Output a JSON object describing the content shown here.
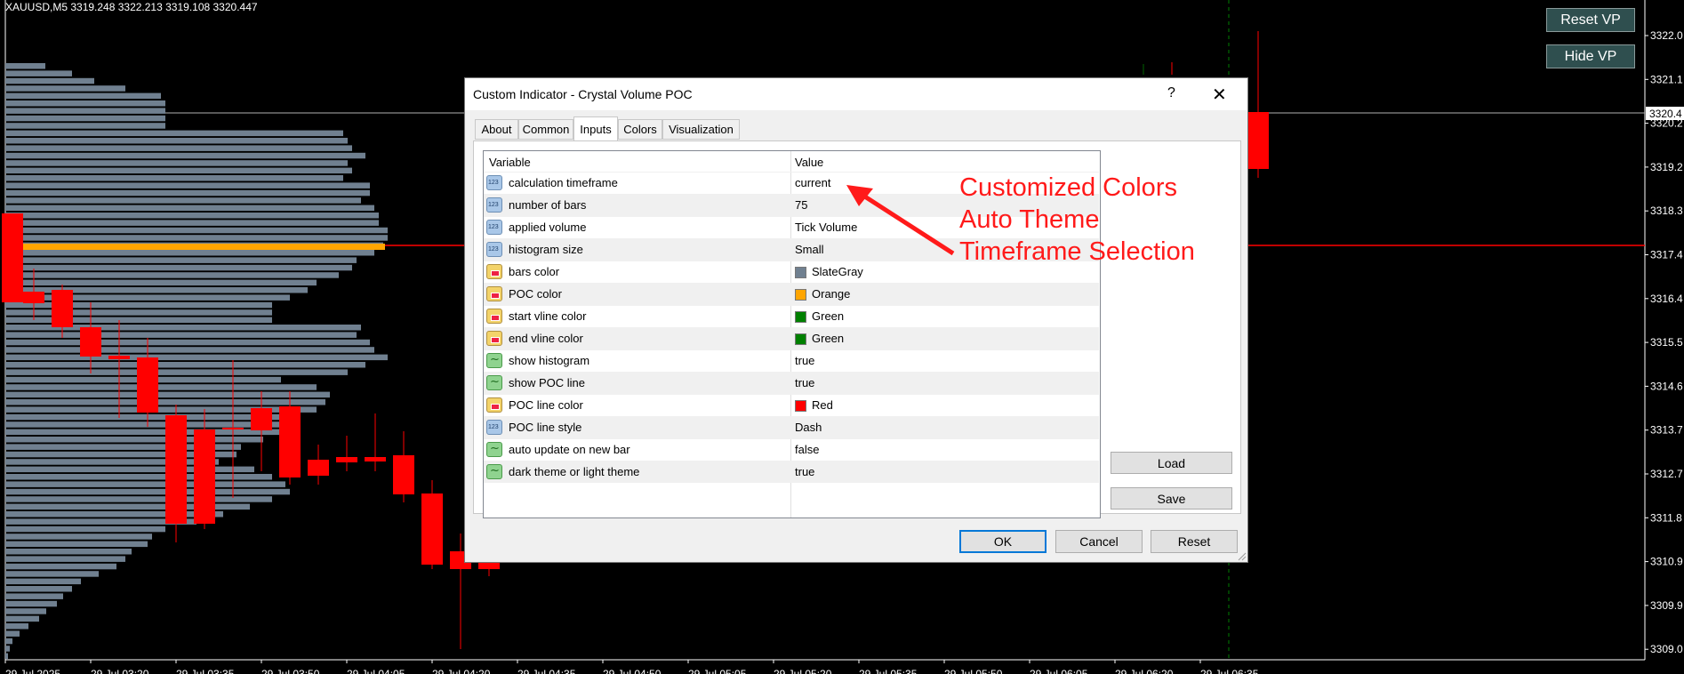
{
  "chart": {
    "symbol_info": "XAUUSD,M5  3319.248 3322.213 3319.108 3320.447",
    "price_labels": [
      "3322.0",
      "3321.1",
      "3320.2",
      "3319.2",
      "3318.3",
      "3317.4",
      "3316.4",
      "3315.5",
      "3314.6",
      "3313.7",
      "3312.7",
      "3311.8",
      "3310.9",
      "3309.9",
      "3309.0"
    ],
    "current_price": "3320.4",
    "time_labels": [
      "29 Jul 2025",
      "29 Jul 03:20",
      "29 Jul 03:35",
      "29 Jul 03:50",
      "29 Jul 04:05",
      "29 Jul 04:20",
      "29 Jul 04:35",
      "29 Jul 04:50",
      "29 Jul 05:05",
      "29 Jul 05:20",
      "29 Jul 05:35",
      "29 Jul 05:50",
      "29 Jul 06:05",
      "29 Jul 06:20",
      "29 Jul 06:35"
    ],
    "colors": {
      "background": "#000000",
      "bars": "#708090",
      "poc": "#ffa500",
      "bull": "#006400",
      "bear": "#ff0000",
      "poc_line": "#ff0000",
      "vline": "#008000"
    }
  },
  "buttons": {
    "reset_vp": "Reset VP",
    "hide_vp": "Hide VP"
  },
  "dialog": {
    "title": "Custom Indicator - Crystal Volume POC",
    "help": "?",
    "close": "✕",
    "tabs": [
      "About",
      "Common",
      "Inputs",
      "Colors",
      "Visualization"
    ],
    "active_tab": "Inputs",
    "columns": {
      "variable": "Variable",
      "value": "Value"
    },
    "rows": [
      {
        "icon": "num",
        "name": "calculation timeframe",
        "value": "current"
      },
      {
        "icon": "num",
        "name": "number of bars",
        "value": "75"
      },
      {
        "icon": "num",
        "name": "applied volume",
        "value": "Tick Volume"
      },
      {
        "icon": "num",
        "name": "histogram size",
        "value": "Small"
      },
      {
        "icon": "clr",
        "name": "bars color",
        "value": "SlateGray",
        "swatch": "#708090"
      },
      {
        "icon": "clr",
        "name": "POC color",
        "value": "Orange",
        "swatch": "#ffa500"
      },
      {
        "icon": "clr",
        "name": "start vline color",
        "value": "Green",
        "swatch": "#008000"
      },
      {
        "icon": "clr",
        "name": "end vline color",
        "value": "Green",
        "swatch": "#008000"
      },
      {
        "icon": "bool",
        "name": "show histogram",
        "value": "true"
      },
      {
        "icon": "bool",
        "name": "show POC line",
        "value": "true"
      },
      {
        "icon": "clr",
        "name": "POC line color",
        "value": "Red",
        "swatch": "#ff0000"
      },
      {
        "icon": "num",
        "name": "POC line style",
        "value": "Dash"
      },
      {
        "icon": "bool",
        "name": "auto update on new bar",
        "value": "false"
      },
      {
        "icon": "bool",
        "name": "dark theme or light theme",
        "value": "true"
      }
    ],
    "load": "Load",
    "save": "Save",
    "ok": "OK",
    "cancel": "Cancel",
    "reset": "Reset"
  },
  "annotation": {
    "lines": [
      "Customized Colors",
      "Auto Theme",
      "Timeframe Selection"
    ],
    "color": "#ff1a1a"
  }
}
